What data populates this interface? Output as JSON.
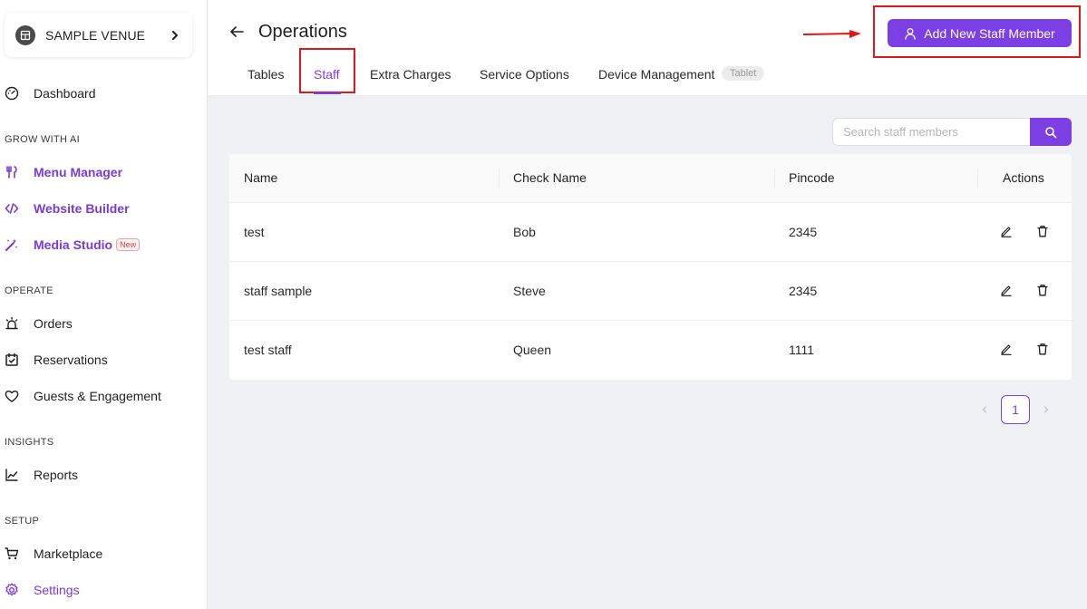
{
  "sidebar": {
    "venue_name": "SAMPLE VENUE",
    "sections": {
      "grow": "GROW WITH AI",
      "operate": "OPERATE",
      "insights": "INSIGHTS",
      "setup": "SETUP"
    },
    "items": {
      "dashboard": "Dashboard",
      "menu_manager": "Menu Manager",
      "website_builder": "Website Builder",
      "media_studio": "Media Studio",
      "media_studio_badge": "New",
      "orders": "Orders",
      "reservations": "Reservations",
      "guests": "Guests & Engagement",
      "reports": "Reports",
      "marketplace": "Marketplace",
      "settings": "Settings"
    },
    "accent_color": "#7a3ad9"
  },
  "header": {
    "title": "Operations",
    "add_button_label": "Add New Staff Member",
    "tabs": {
      "tables": "Tables",
      "staff": "Staff",
      "extra_charges": "Extra Charges",
      "service_options": "Service Options",
      "device_management": "Device Management",
      "device_badge": "Tablet"
    },
    "active_tab": "Staff"
  },
  "search": {
    "placeholder": "Search staff members",
    "value": ""
  },
  "table": {
    "columns": {
      "name": "Name",
      "check_name": "Check Name",
      "pincode": "Pincode",
      "actions": "Actions"
    },
    "rows": [
      {
        "name": "test",
        "check_name": "Bob",
        "pincode": "2345"
      },
      {
        "name": "staff sample",
        "check_name": "Steve",
        "pincode": "2345"
      },
      {
        "name": "test staff",
        "check_name": "Queen",
        "pincode": "1111"
      }
    ]
  },
  "pagination": {
    "current_page": "1"
  },
  "colors": {
    "primary": "#7b3fe4",
    "highlight": "#e01818"
  }
}
